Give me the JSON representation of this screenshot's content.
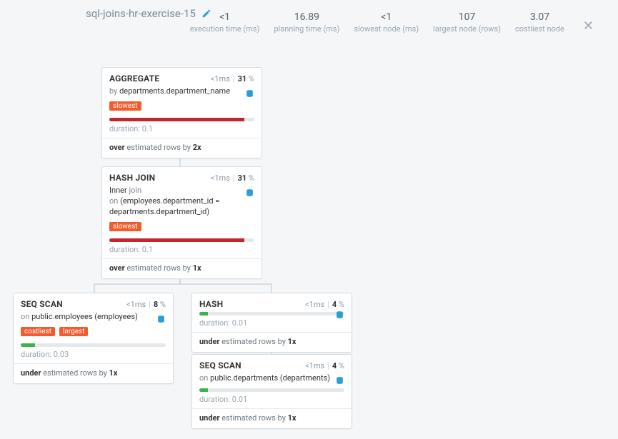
{
  "header": {
    "title": "sql-joins-hr-exercise-15"
  },
  "metrics": {
    "execution_time": {
      "value": "<1",
      "label": "execution time (ms)"
    },
    "planning_time": {
      "value": "16.89",
      "label": "planning time (ms)"
    },
    "slowest_node": {
      "value": "<1",
      "label": "slowest node (ms)"
    },
    "largest_node": {
      "value": "107",
      "label": "largest node (rows)"
    },
    "costliest_node": {
      "value": "3.07",
      "label": "costliest node"
    }
  },
  "nodes": {
    "aggregate": {
      "title": "AGGREGATE",
      "time": "<1ms",
      "percent": "31",
      "detail_prefix": "by ",
      "detail": "departments.department_name",
      "badges": [
        "slowest"
      ],
      "bar_color": "red",
      "bar_pct": 93,
      "duration": "duration: 0.1",
      "est_dir": "over",
      "est_mid": " estimated rows by ",
      "est_x": "2x"
    },
    "hashjoin": {
      "title": "HASH JOIN",
      "time": "<1ms",
      "percent": "31",
      "detail_line1_a": "Inner ",
      "detail_line1_b": "join",
      "detail_line2_a": "on ",
      "detail_line2_b": "(employees.department_id = departments.department_id)",
      "badges": [
        "slowest"
      ],
      "bar_color": "red",
      "bar_pct": 93,
      "duration": "duration: 0.1",
      "est_dir": "over",
      "est_mid": " estimated rows by ",
      "est_x": "1x"
    },
    "seqscan_emp": {
      "title": "SEQ SCAN",
      "time": "<1ms",
      "percent": "8",
      "detail_prefix": "on ",
      "detail": "public.employees (employees)",
      "badges": [
        "costliest",
        "largest"
      ],
      "bar_color": "green",
      "bar_pct": 10,
      "duration": "duration: 0.03",
      "est_dir": "under",
      "est_mid": " estimated rows by ",
      "est_x": "1x"
    },
    "hash": {
      "title": "HASH",
      "time": "<1ms",
      "percent": "4",
      "bar_color": "green",
      "bar_pct": 6,
      "duration": "duration: 0.01",
      "est_dir": "under",
      "est_mid": " estimated rows by ",
      "est_x": "1x"
    },
    "seqscan_dep": {
      "title": "SEQ SCAN",
      "time": "<1ms",
      "percent": "4",
      "detail_prefix": "on ",
      "detail": "public.departments (departments)",
      "bar_color": "green",
      "bar_pct": 6,
      "duration": "duration: 0.01",
      "est_dir": "under",
      "est_mid": " estimated rows by ",
      "est_x": "1x"
    }
  },
  "labels": {
    "percent_symbol": " %"
  }
}
